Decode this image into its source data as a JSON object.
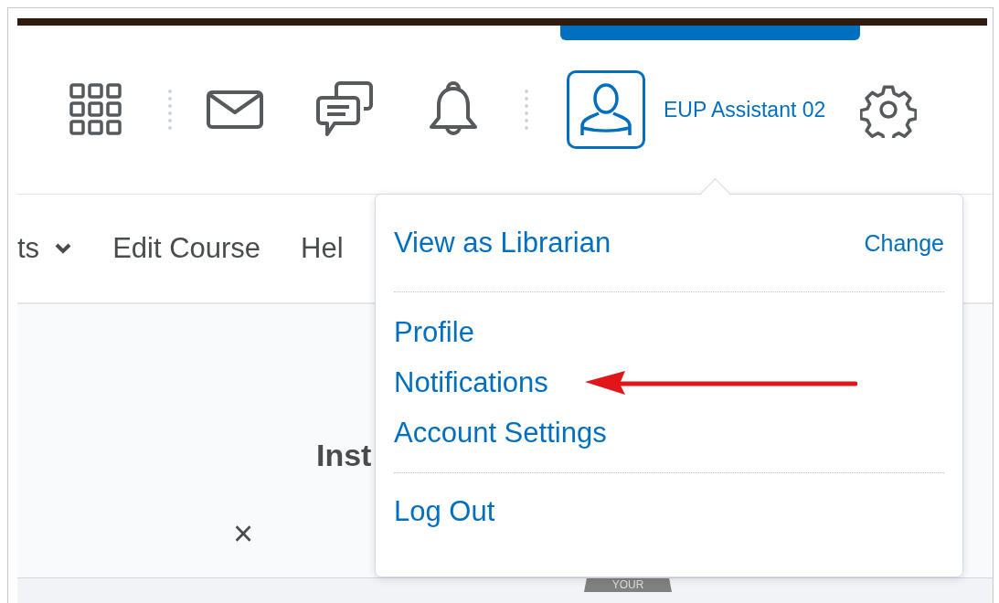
{
  "header": {
    "user_name": "EUP Assistant 02"
  },
  "nav": [
    {
      "label": "ts",
      "has_caret": true
    },
    {
      "label": "Edit Course",
      "has_caret": false
    },
    {
      "label": "Hel",
      "has_caret": false
    }
  ],
  "content": {
    "heading": "Inst",
    "close": "×",
    "tab": "YOUR"
  },
  "menu": {
    "role": "View as Librarian",
    "change": "Change",
    "groups": [
      [
        "Profile",
        "Notifications",
        "Account Settings"
      ],
      [
        "Log Out"
      ]
    ]
  },
  "annotation": {
    "kind": "arrow"
  }
}
